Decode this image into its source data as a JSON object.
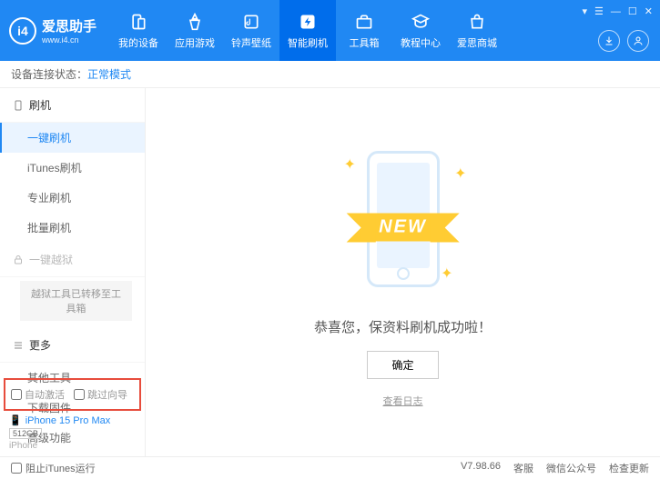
{
  "header": {
    "brand": "爱思助手",
    "url": "www.i4.cn",
    "logo_letter": "i4"
  },
  "nav": [
    {
      "label": "我的设备",
      "icon": "devices"
    },
    {
      "label": "应用游戏",
      "icon": "apps"
    },
    {
      "label": "铃声壁纸",
      "icon": "music"
    },
    {
      "label": "智能刷机",
      "icon": "flash",
      "active": true
    },
    {
      "label": "工具箱",
      "icon": "toolbox"
    },
    {
      "label": "教程中心",
      "icon": "tutorial"
    },
    {
      "label": "爱思商城",
      "icon": "shop"
    }
  ],
  "status": {
    "label": "设备连接状态：",
    "mode": "正常模式"
  },
  "sidebar": {
    "group_flash": "刷机",
    "items_flash": [
      "一键刷机",
      "iTunes刷机",
      "专业刷机",
      "批量刷机"
    ],
    "group_jailbreak": "一键越狱",
    "jailbreak_note": "越狱工具已转移至工具箱",
    "group_more": "更多",
    "items_more": [
      "其他工具",
      "下载固件",
      "高级功能"
    ],
    "checkbox_auto_activate": "自动激活",
    "checkbox_skip_guide": "跳过向导"
  },
  "device": {
    "name": "iPhone 15 Pro Max",
    "storage": "512GB",
    "type": "iPhone"
  },
  "main": {
    "ribbon": "NEW",
    "success_text": "恭喜您，保资料刷机成功啦！",
    "ok_button": "确定",
    "log_link": "查看日志"
  },
  "footer": {
    "block_itunes": "阻止iTunes运行",
    "version": "V7.98.66",
    "links": [
      "客服",
      "微信公众号",
      "检查更新"
    ]
  }
}
